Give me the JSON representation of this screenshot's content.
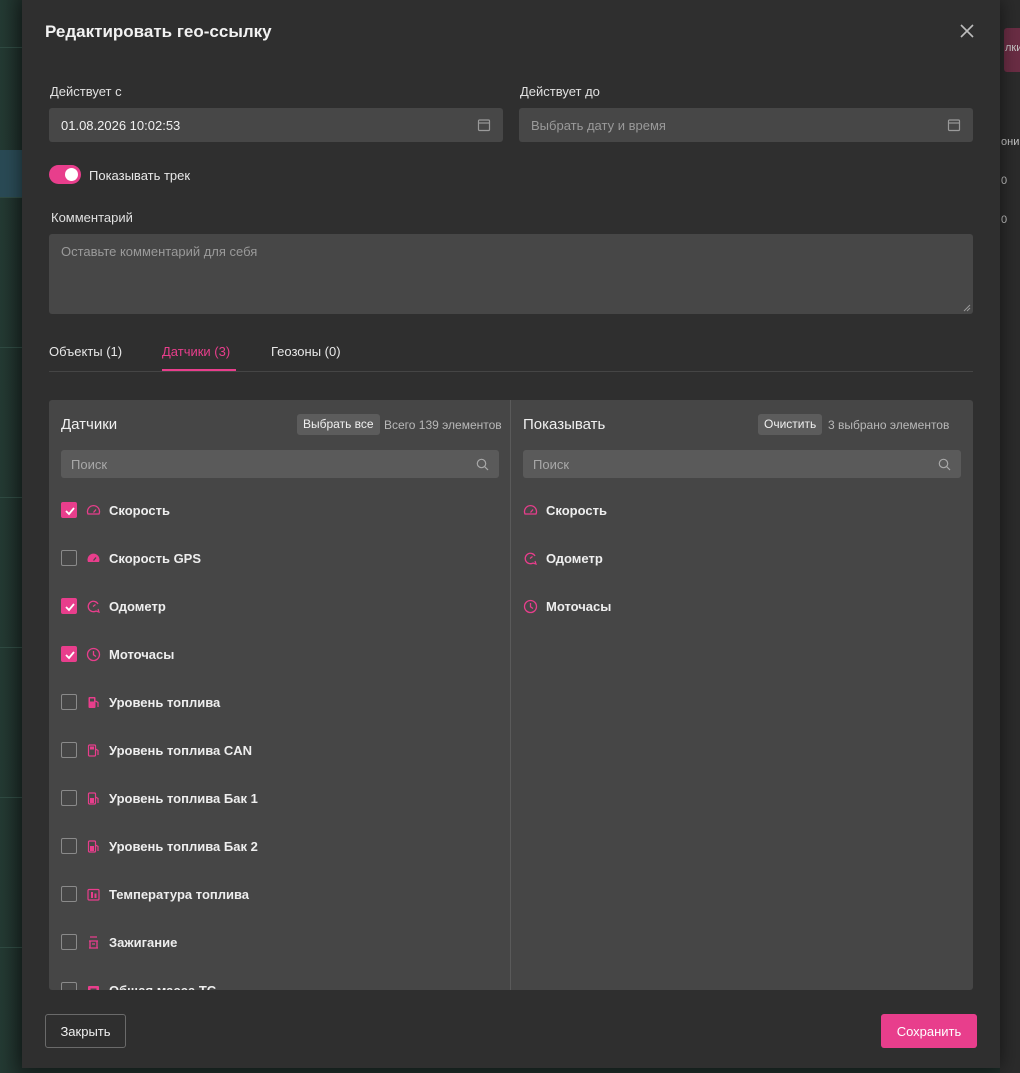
{
  "modal": {
    "title": "Редактировать гео-ссылку"
  },
  "valid_from": {
    "label": "Действует с",
    "value": "01.08.2026 10:02:53"
  },
  "valid_to": {
    "label": "Действует до",
    "placeholder": "Выбрать дату и время"
  },
  "show_track": {
    "label": "Показывать трек",
    "enabled": true
  },
  "comment": {
    "label": "Комментарий",
    "placeholder": "Оставьте комментарий для себя"
  },
  "tabs": [
    {
      "label": "Объекты (1)",
      "active": false
    },
    {
      "label": "Датчики (3)",
      "active": true
    },
    {
      "label": "Геозоны (0)",
      "active": false
    }
  ],
  "sensors_pane": {
    "title": "Датчики",
    "select_all": "Выбрать все",
    "count_text": "Всего 139 элементов",
    "search_placeholder": "Поиск",
    "items": [
      {
        "label": "Скорость",
        "checked": true,
        "icon": "speedometer-icon"
      },
      {
        "label": "Скорость GPS",
        "checked": false,
        "icon": "speedometer-filled-icon"
      },
      {
        "label": "Одометр",
        "checked": true,
        "icon": "odometer-icon"
      },
      {
        "label": "Моточасы",
        "checked": true,
        "icon": "clock-icon"
      },
      {
        "label": "Уровень топлива",
        "checked": false,
        "icon": "fuel-icon"
      },
      {
        "label": "Уровень топлива CAN",
        "checked": false,
        "icon": "fuel-can-icon"
      },
      {
        "label": "Уровень топлива Бак 1",
        "checked": false,
        "icon": "fuel-tank-icon"
      },
      {
        "label": "Уровень топлива Бак 2",
        "checked": false,
        "icon": "fuel-tank-icon"
      },
      {
        "label": "Температура топлива",
        "checked": false,
        "icon": "fuel-temperature-icon"
      },
      {
        "label": "Зажигание",
        "checked": false,
        "icon": "ignition-icon"
      },
      {
        "label": "Общая масса ТС",
        "checked": false,
        "icon": "weight-icon"
      }
    ]
  },
  "shown_pane": {
    "title": "Показывать",
    "clear": "Очистить",
    "count_text": "3 выбрано элементов",
    "search_placeholder": "Поиск",
    "items": [
      {
        "label": "Скорость",
        "icon": "speedometer-icon"
      },
      {
        "label": "Одометр",
        "icon": "odometer-icon"
      },
      {
        "label": "Моточасы",
        "icon": "clock-icon"
      }
    ]
  },
  "footer": {
    "close": "Закрыть",
    "save": "Сохранить"
  },
  "background": {
    "right_fragments": [
      "лки",
      "они",
      "0",
      "0"
    ]
  },
  "colors": {
    "accent": "#e83e8c",
    "modal_bg": "#2f2f2f",
    "field_bg": "#474747",
    "panel_bg": "#464646"
  }
}
